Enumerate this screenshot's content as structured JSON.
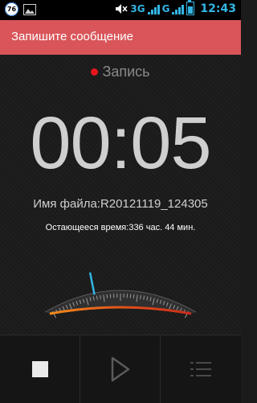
{
  "status_bar": {
    "notification_count": "76",
    "network_1": "3G",
    "network_2": "G",
    "time": "12:43"
  },
  "action_bar": {
    "title": "Запишите сообщение"
  },
  "recorder": {
    "state_label": "Запись",
    "elapsed": "00:05",
    "filename": "Имя файла:R20121119_124305",
    "remaining": "Остающееся время:336 час. 44 мин.",
    "level": 0.32
  },
  "controls": [
    {
      "name": "stop"
    },
    {
      "name": "play"
    },
    {
      "name": "list"
    }
  ],
  "colors": {
    "accent": "#d9555a",
    "record_dot": "#e8161c",
    "status_blue": "#33b5e5",
    "needle": "#33b5e5"
  }
}
